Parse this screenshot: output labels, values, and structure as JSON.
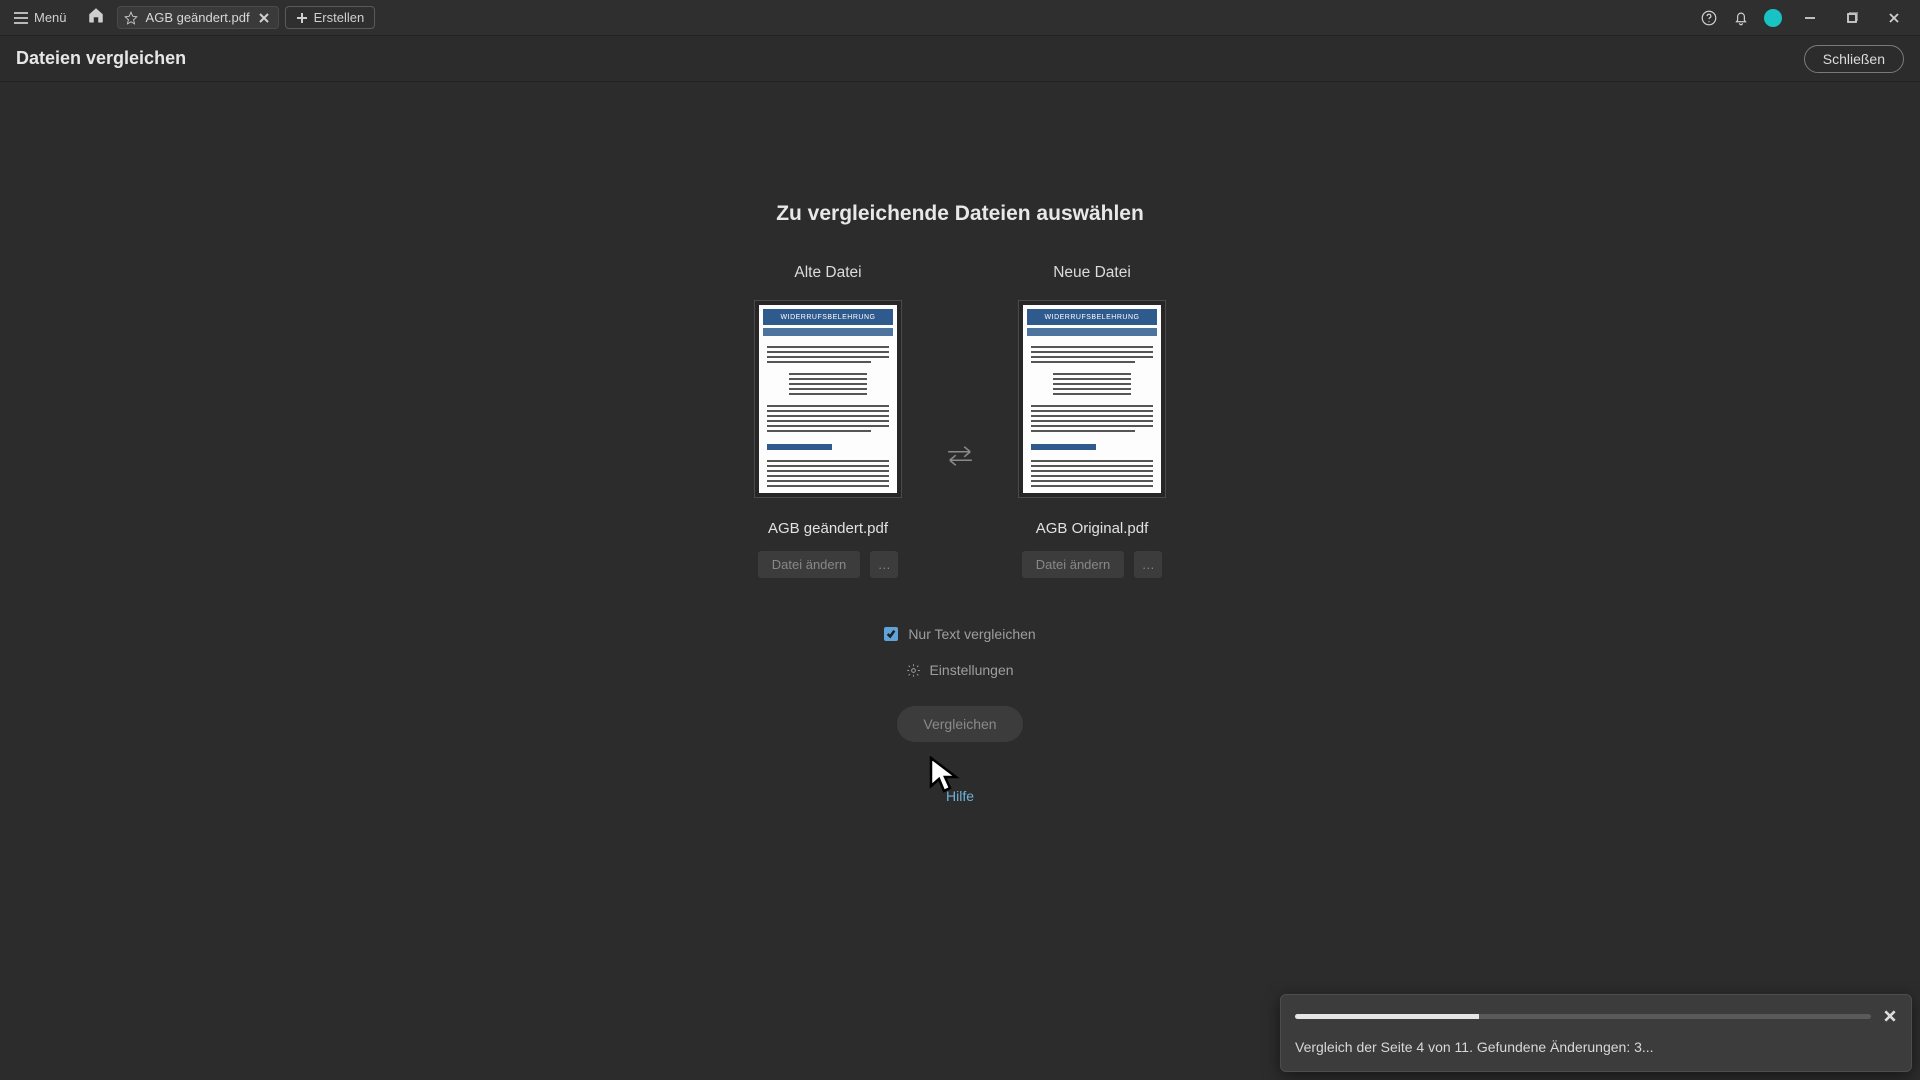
{
  "titlebar": {
    "menu_label": "Menü",
    "tab_label": "AGB geändert.pdf",
    "create_label": "Erstellen"
  },
  "header": {
    "tool_title": "Dateien vergleichen",
    "close_label": "Schließen"
  },
  "main": {
    "heading": "Zu vergleichende Dateien auswählen",
    "old": {
      "label": "Alte Datei",
      "filename": "AGB geändert.pdf",
      "change_file": "Datei ändern",
      "more": "…"
    },
    "new": {
      "label": "Neue Datei",
      "filename": "AGB Original.pdf",
      "change_file": "Datei ändern",
      "more": "…"
    },
    "thumb_banner": "WIDERRUFSBELEHRUNG",
    "text_only": "Nur Text vergleichen",
    "settings": "Einstellungen",
    "compare": "Vergleichen",
    "help": "Hilfe"
  },
  "toast": {
    "text": "Vergleich der Seite 4 von 11. Gefundene Änderungen: 3...",
    "progress_percent": 32
  }
}
